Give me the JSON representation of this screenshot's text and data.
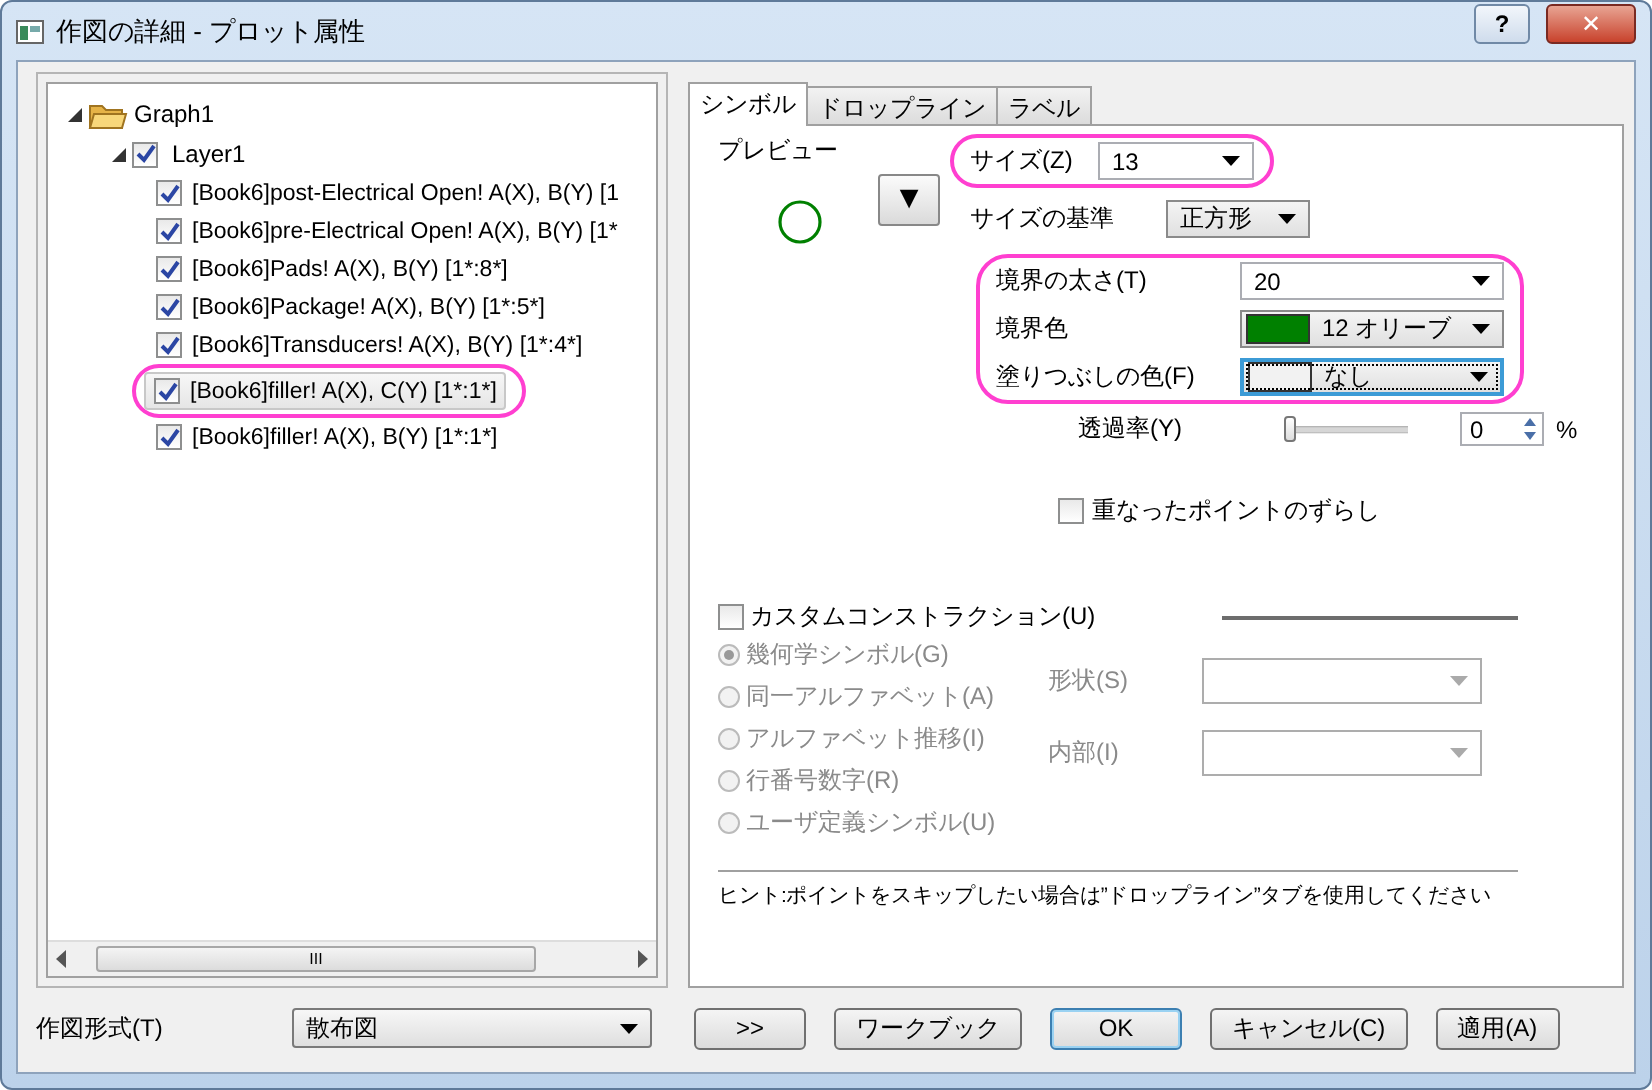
{
  "window": {
    "title": "作図の詳細 - プロット属性",
    "help": "?",
    "close": "✕"
  },
  "tree": [
    {
      "label": "Graph1",
      "kind": "folder",
      "expanded": true,
      "children": [
        {
          "label": "Layer1",
          "kind": "layer",
          "checked": true,
          "expanded": true,
          "children": [
            {
              "label": "[Book6]post-Electrical Open! A(X), B(Y) [1",
              "kind": "plot",
              "checked": true,
              "selected": false,
              "highlighted": false
            },
            {
              "label": "[Book6]pre-Electrical Open! A(X), B(Y) [1*",
              "kind": "plot",
              "checked": true,
              "selected": false,
              "highlighted": false
            },
            {
              "label": "[Book6]Pads! A(X), B(Y) [1*:8*]",
              "kind": "plot",
              "checked": true,
              "selected": false,
              "highlighted": false
            },
            {
              "label": "[Book6]Package! A(X), B(Y) [1*:5*]",
              "kind": "plot",
              "checked": true,
              "selected": false,
              "highlighted": false
            },
            {
              "label": "[Book6]Transducers! A(X), B(Y) [1*:4*]",
              "kind": "plot",
              "checked": true,
              "selected": false,
              "highlighted": false
            },
            {
              "label": "[Book6]filler! A(X), C(Y) [1*:1*]",
              "kind": "plot",
              "checked": true,
              "selected": true,
              "highlighted": true
            },
            {
              "label": "[Book6]filler! A(X), B(Y) [1*:1*]",
              "kind": "plot",
              "checked": true,
              "selected": false,
              "highlighted": false
            }
          ]
        }
      ]
    }
  ],
  "scrollbar_thumb": "III",
  "plot_type": {
    "label": "作図形式(T)",
    "value": "散布図"
  },
  "tabs": [
    {
      "label": "シンボル",
      "selected": true
    },
    {
      "label": "ドロップライン",
      "selected": false
    },
    {
      "label": "ラベル",
      "selected": false
    }
  ],
  "symbol": {
    "preview_label": "プレビュー",
    "menu_button": "▼",
    "setting_groups": [
      {
        "highlighted": true,
        "rows": [
          {
            "kind": "plain",
            "label": "サイズ(Z)",
            "value": "13",
            "focused": false
          }
        ]
      },
      {
        "highlighted": false,
        "rows": [
          {
            "kind": "plain",
            "label": "サイズの基準",
            "value": "正方形",
            "focused": false
          }
        ]
      },
      {
        "highlighted": true,
        "rows": [
          {
            "kind": "plain",
            "label": "境界の太さ(T)",
            "value": "20",
            "focused": false
          },
          {
            "kind": "color",
            "label": "境界色",
            "value": "12 オリーブ",
            "color": "#008000",
            "focused": false
          },
          {
            "kind": "color",
            "label": "塗りつぶしの色(F)",
            "value": "なし",
            "color": "#f2f2f2",
            "focused": true
          }
        ]
      }
    ],
    "transparency": {
      "label": "透過率(Y)",
      "level": 0,
      "value": "0",
      "unit": "%"
    },
    "offset_overlap": {
      "label": "重なったポイントのずらし",
      "checked": false
    }
  },
  "custom": {
    "label": "カスタムコンストラクション(U)",
    "checked": false,
    "options": [
      {
        "label": "幾何学シンボル(G)",
        "selected": true
      },
      {
        "label": "同一アルファベット(A)",
        "selected": false
      },
      {
        "label": "アルファベット推移(I)",
        "selected": false
      },
      {
        "label": "行番号数字(R)",
        "selected": false
      },
      {
        "label": "ユーザ定義シンボル(U)",
        "selected": false
      }
    ],
    "fields": [
      {
        "label": "形状(S)",
        "disabled": true
      },
      {
        "label": "内部(I)",
        "disabled": true
      }
    ]
  },
  "hint": "ヒント:ポイントをスキップしたい場合は”ドロップライン”タブを使用してください",
  "buttons": [
    {
      "label": ">>",
      "default": false
    },
    {
      "label": "ワークブック",
      "default": false
    },
    {
      "label": "OK",
      "default": true
    },
    {
      "label": "キャンセル(C)",
      "default": false
    },
    {
      "label": "適用(A)",
      "default": false
    }
  ]
}
